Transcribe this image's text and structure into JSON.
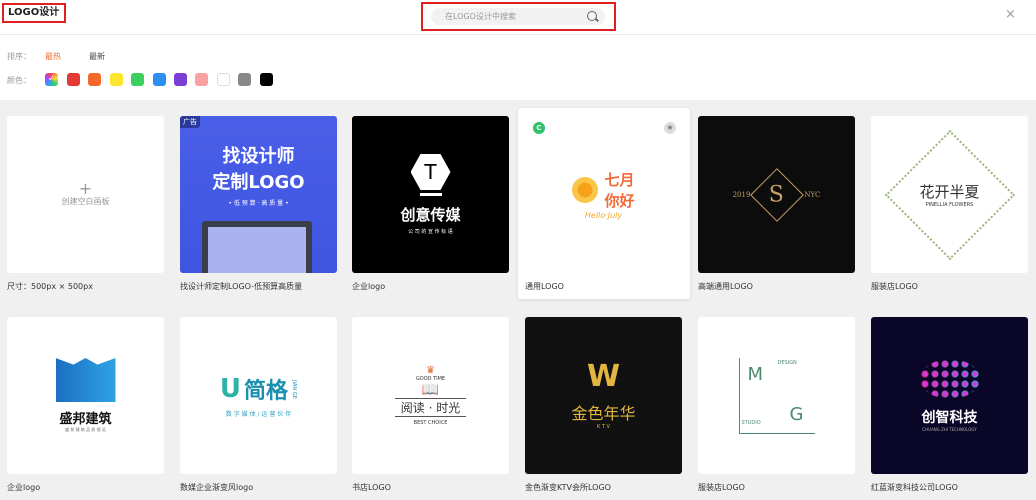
{
  "header": {
    "title": "LOGO设计",
    "search_placeholder": "在LOGO设计中搜索",
    "close": "×"
  },
  "filters": {
    "sort_label": "排序：",
    "sort_options": [
      "最热",
      "最新"
    ],
    "active_sort": "最热",
    "color_label": "颜色：",
    "colors": [
      "#e53935",
      "#f4692a",
      "#fde52d",
      "#3ccf5e",
      "#2d8ff0",
      "#7b3fd6",
      "#f9a1a1",
      "#ffffff",
      "#888888",
      "#000000"
    ],
    "accent": "#f4692a"
  },
  "blank": {
    "plus": "+",
    "label": "创建空白画板",
    "size": "尺寸：500px × 500px"
  },
  "templates": [
    {
      "caption": "找设计师定制LOGO-低预算高质量",
      "badge": "广告",
      "lines": [
        "找设计师",
        "定制LOGO",
        "• 低 预 算 · 高 质 量 •"
      ]
    },
    {
      "caption": "企业logo",
      "lines": [
        "T",
        "创意传媒",
        "公 司 的 宣 传 标 语"
      ]
    },
    {
      "caption": "通用LOGO",
      "badge": "C",
      "lines": [
        "七月",
        "你好",
        "Hello July"
      ]
    },
    {
      "caption": "高端通用LOGO",
      "lines": [
        "2019",
        "S",
        "NYC"
      ]
    },
    {
      "caption": "服装店LOGO",
      "lines": [
        "花开半夏",
        "PINELLIA FLOWERS"
      ]
    },
    {
      "caption": "企业logo",
      "lines": [
        "盛邦建筑",
        "盛 邦 建 筑 品 质 保 证"
      ]
    },
    {
      "caption": "数媒企业渐变风logo",
      "lines": [
        "简格",
        "JIAN GE",
        "数 字 媒 体 / 运 营 伙 伴"
      ]
    },
    {
      "caption": "书店LOGO",
      "lines": [
        "GOOD TIME",
        "阅读 · 时光",
        "BEST CHOICE"
      ]
    },
    {
      "caption": "金色渐变KTV会所LOGO",
      "lines": [
        "金色年华",
        "K T V"
      ]
    },
    {
      "caption": "服装店LOGO",
      "lines": [
        "M",
        "G",
        "DESIGN",
        "STUDIO"
      ]
    },
    {
      "caption": "红蓝渐变科技公司LOGO",
      "lines": [
        "创智科技",
        "CHUANG ZHI TECHNOLOGY"
      ]
    }
  ]
}
